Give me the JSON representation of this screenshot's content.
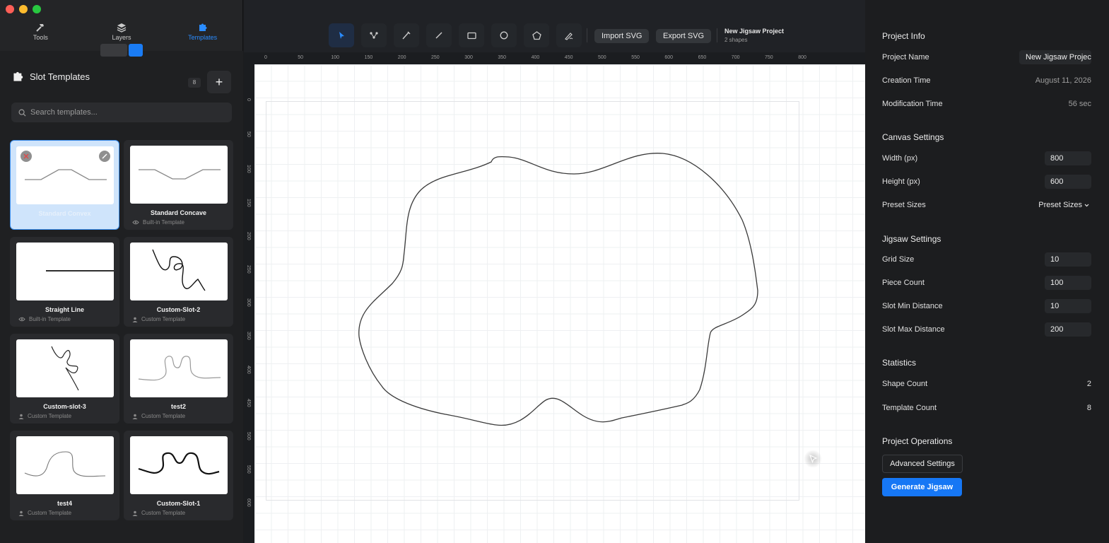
{
  "window": {
    "traffic_colors": [
      "#fe5f57",
      "#febc2e",
      "#28c840"
    ]
  },
  "nav": {
    "tabs": [
      {
        "label": "Tools",
        "icon": "hammer-icon"
      },
      {
        "label": "Layers",
        "icon": "layers-icon"
      },
      {
        "label": "Templates",
        "icon": "puzzle-icon",
        "active": true
      }
    ]
  },
  "templates_panel": {
    "title": "Slot Templates",
    "count": "8",
    "add_label": "+",
    "search_placeholder": "Search templates...",
    "cards": [
      {
        "name": "Standard Convex",
        "type": "",
        "selected": true
      },
      {
        "name": "Standard Concave",
        "type": "Built-in Template"
      },
      {
        "name": "Straight Line",
        "type": "Built-in Template"
      },
      {
        "name": "Custom-Slot-2",
        "type": "Custom Template"
      },
      {
        "name": "Custom-slot-3",
        "type": "Custom Template"
      },
      {
        "name": "test2",
        "type": "Custom Template"
      },
      {
        "name": "test4",
        "type": "Custom Template"
      },
      {
        "name": "Custom-Slot-1",
        "type": "Custom Template"
      }
    ]
  },
  "toolbar": {
    "tools": [
      "select-tool",
      "node-tool",
      "pen-tool",
      "line-tool",
      "rectangle-tool",
      "ellipse-tool",
      "polygon-tool",
      "freehand-tool"
    ],
    "import_label": "Import SVG",
    "export_label": "Export SVG",
    "project_name": "New Jigsaw Project",
    "project_shapes": "2 shapes"
  },
  "rulers": {
    "top": [
      "0",
      "50",
      "100",
      "150",
      "200",
      "250",
      "300",
      "350",
      "400",
      "450",
      "500",
      "550",
      "600",
      "650",
      "700",
      "750",
      "800"
    ],
    "left": [
      "0",
      "50",
      "100",
      "150",
      "200",
      "250",
      "300",
      "350",
      "400",
      "450",
      "500",
      "550",
      "600"
    ]
  },
  "right_panel": {
    "project_info": {
      "title": "Project Info",
      "name_label": "Project Name",
      "name_value": "New Jigsaw Project",
      "creation_label": "Creation Time",
      "creation_value": "August 11, 2026",
      "modification_label": "Modification Time",
      "modification_value": "56 sec"
    },
    "canvas_settings": {
      "title": "Canvas Settings",
      "width_label": "Width (px)",
      "width_value": "800",
      "height_label": "Height (px)",
      "height_value": "600",
      "preset_label": "Preset Sizes",
      "preset_value": "Preset Sizes"
    },
    "jigsaw_settings": {
      "title": "Jigsaw Settings",
      "grid_label": "Grid Size",
      "grid_value": "10",
      "piece_label": "Piece Count",
      "piece_value": "100",
      "slot_min_label": "Slot Min Distance",
      "slot_min_value": "10",
      "slot_max_label": "Slot Max Distance",
      "slot_max_value": "200"
    },
    "statistics": {
      "title": "Statistics",
      "shape_label": "Shape Count",
      "shape_value": "2",
      "template_label": "Template Count",
      "template_value": "8"
    },
    "operations": {
      "title": "Project Operations",
      "advanced_label": "Advanced Settings",
      "generate_label": "Generate Jigsaw"
    }
  },
  "colors": {
    "accent": "#1677f5",
    "active_tab": "#2a8cff"
  }
}
